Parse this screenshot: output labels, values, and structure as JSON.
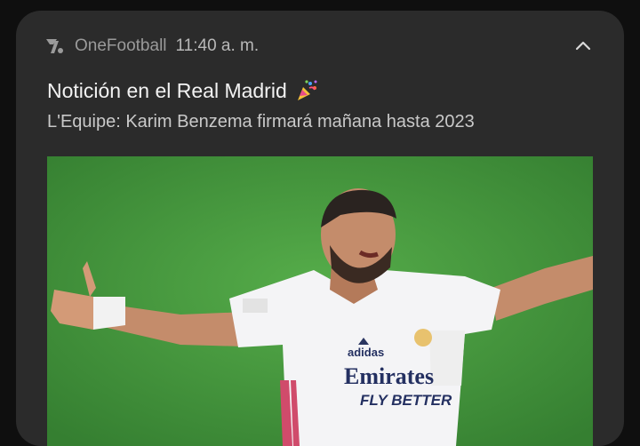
{
  "notification": {
    "app_name": "OneFootball",
    "time": "11:40 a. m.",
    "title": "Notición en el Real Madrid",
    "title_emoji": "party-popper-icon",
    "subtitle": "L'Equipe: Karim Benzema firmará mañana hasta 2023",
    "collapse_icon": "chevron-up-icon",
    "app_icon": "onefootball-logo-icon"
  },
  "image": {
    "subject": "photo",
    "shirt_sponsor_line1": "Emirates",
    "shirt_sponsor_line2": "FLY BETTER",
    "kit_brand": "adidas"
  },
  "colors": {
    "card": "#2b2b2b",
    "pitch": "#4ea244",
    "title": "#f2f2f2",
    "subtitle": "#c9c9c9"
  }
}
